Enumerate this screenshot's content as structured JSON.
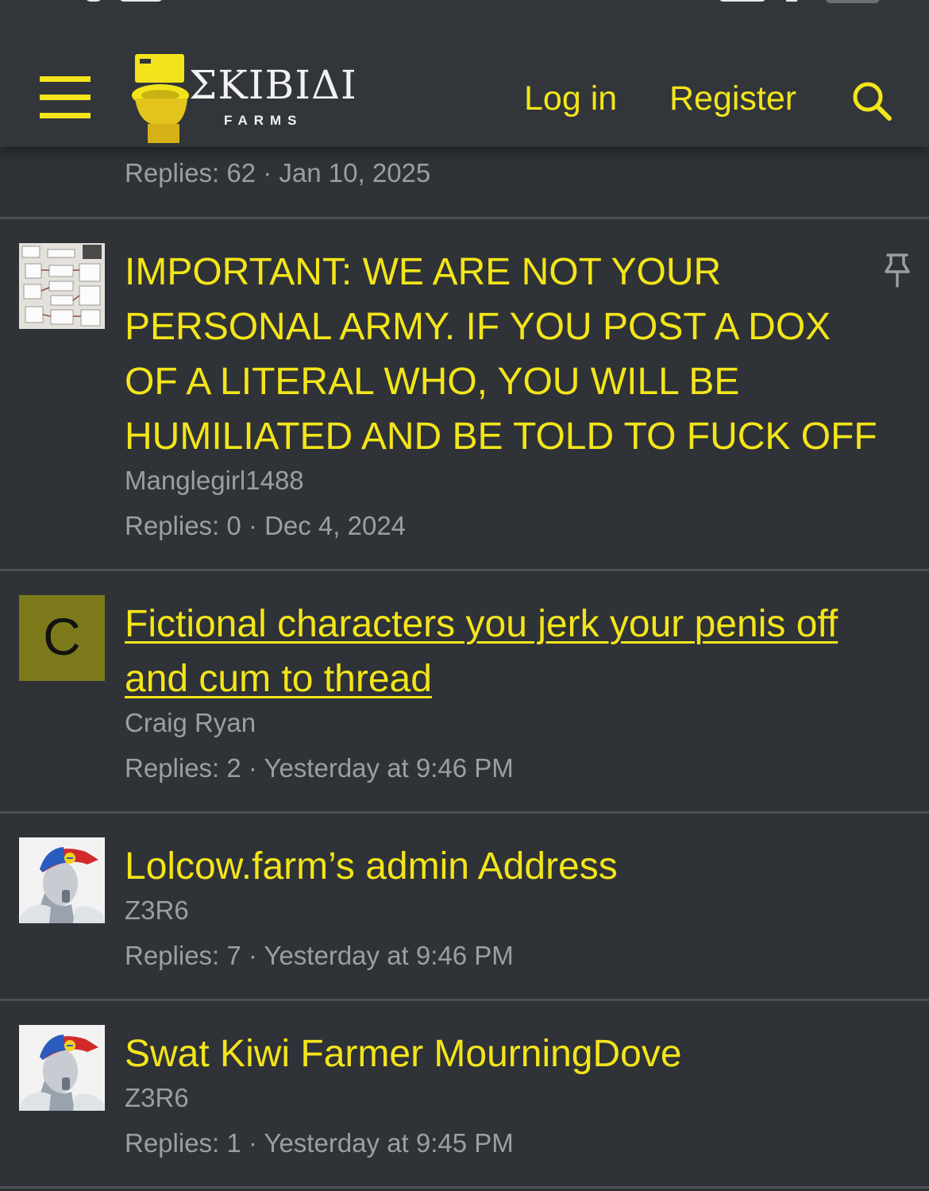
{
  "header": {
    "logo_text": "ΣKIBIΔI",
    "logo_subtext": "FARMS",
    "login_label": "Log in",
    "register_label": "Register",
    "colors": {
      "accent": "#f3e51a",
      "background": "#32363a"
    },
    "icons": [
      "menu-icon",
      "toilet-logo",
      "search-icon"
    ]
  },
  "threads": [
    {
      "meta": "Replies: 62 · Jan 10, 2025"
    },
    {
      "title": "IMPORTANT: WE ARE NOT YOUR PERSONAL ARMY. IF YOU POST A DOX OF A LITERAL WHO, YOU WILL BE HUMILIATED AND BE TOLD TO FUCK OFF",
      "title_lines": [
        "IMPORTANT: WE ARE NOT YOUR",
        "PERSONAL ARMY. IF YOU POST A DOX",
        "OF A LITERAL WHO, YOU WILL BE",
        "HUMILIATED AND BE TOLD TO FUCK OFF"
      ],
      "author": "Manglegirl1488",
      "meta": "Replies: 0 · Dec 4, 2024",
      "pinned_icon": "pin-icon"
    },
    {
      "title_lines": [
        "Fictional characters you jerk your penis off",
        "and cum to thread"
      ],
      "author": "Craig Ryan",
      "meta": "Replies: 2 · Yesterday at 9:46 PM",
      "avatar_letter": "C"
    },
    {
      "title": "Lolcow.farm’s admin Address",
      "author": "Z3R6",
      "meta": "Replies: 7 · Yesterday at 9:46 PM"
    },
    {
      "title": "Swat Kiwi Farmer MourningDove",
      "author": "Z3R6",
      "meta": "Replies: 1 · Yesterday at 9:45 PM"
    }
  ]
}
